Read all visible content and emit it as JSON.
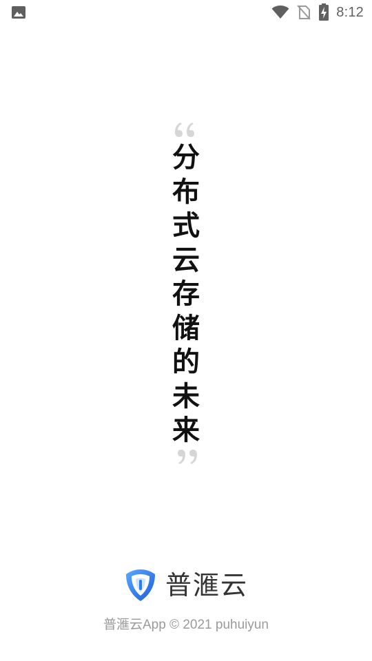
{
  "status_bar": {
    "time": "8:12",
    "left_icon": "image-notification-icon",
    "icons": [
      "wifi-icon",
      "no-sim-icon",
      "battery-charging-icon"
    ]
  },
  "slogan": {
    "open_quote": "“",
    "close_quote": "”",
    "chars": [
      "分",
      "布",
      "式",
      "云",
      "存",
      "储",
      "的",
      "未",
      "来"
    ]
  },
  "brand": {
    "logo": "shield-logo-icon",
    "name": "普滙云",
    "accent_color": "#2b7cf0"
  },
  "footer": {
    "copyright": "普滙云App © 2021 puhuiyun"
  }
}
